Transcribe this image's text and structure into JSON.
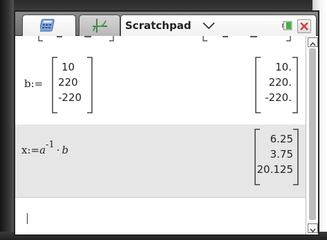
{
  "tabs": {
    "title": "Scratchpad"
  },
  "history": [
    {
      "lhs": "b:=",
      "input_matrix": [
        "10",
        "220",
        "-220"
      ],
      "result_matrix": [
        "10.",
        "220.",
        "-220."
      ]
    },
    {
      "lhs_var": "x:=",
      "lhs_a": "a",
      "lhs_exp": "-1",
      "lhs_dot": "·",
      "lhs_b": "b",
      "result_matrix": [
        "6.25",
        "3.75",
        "20.125"
      ]
    }
  ],
  "entry": {
    "value": ""
  },
  "colors": {
    "highlight_row": "#e6e6e6",
    "close_red": "#d23a3a",
    "battery_green": "#3bb53b"
  }
}
